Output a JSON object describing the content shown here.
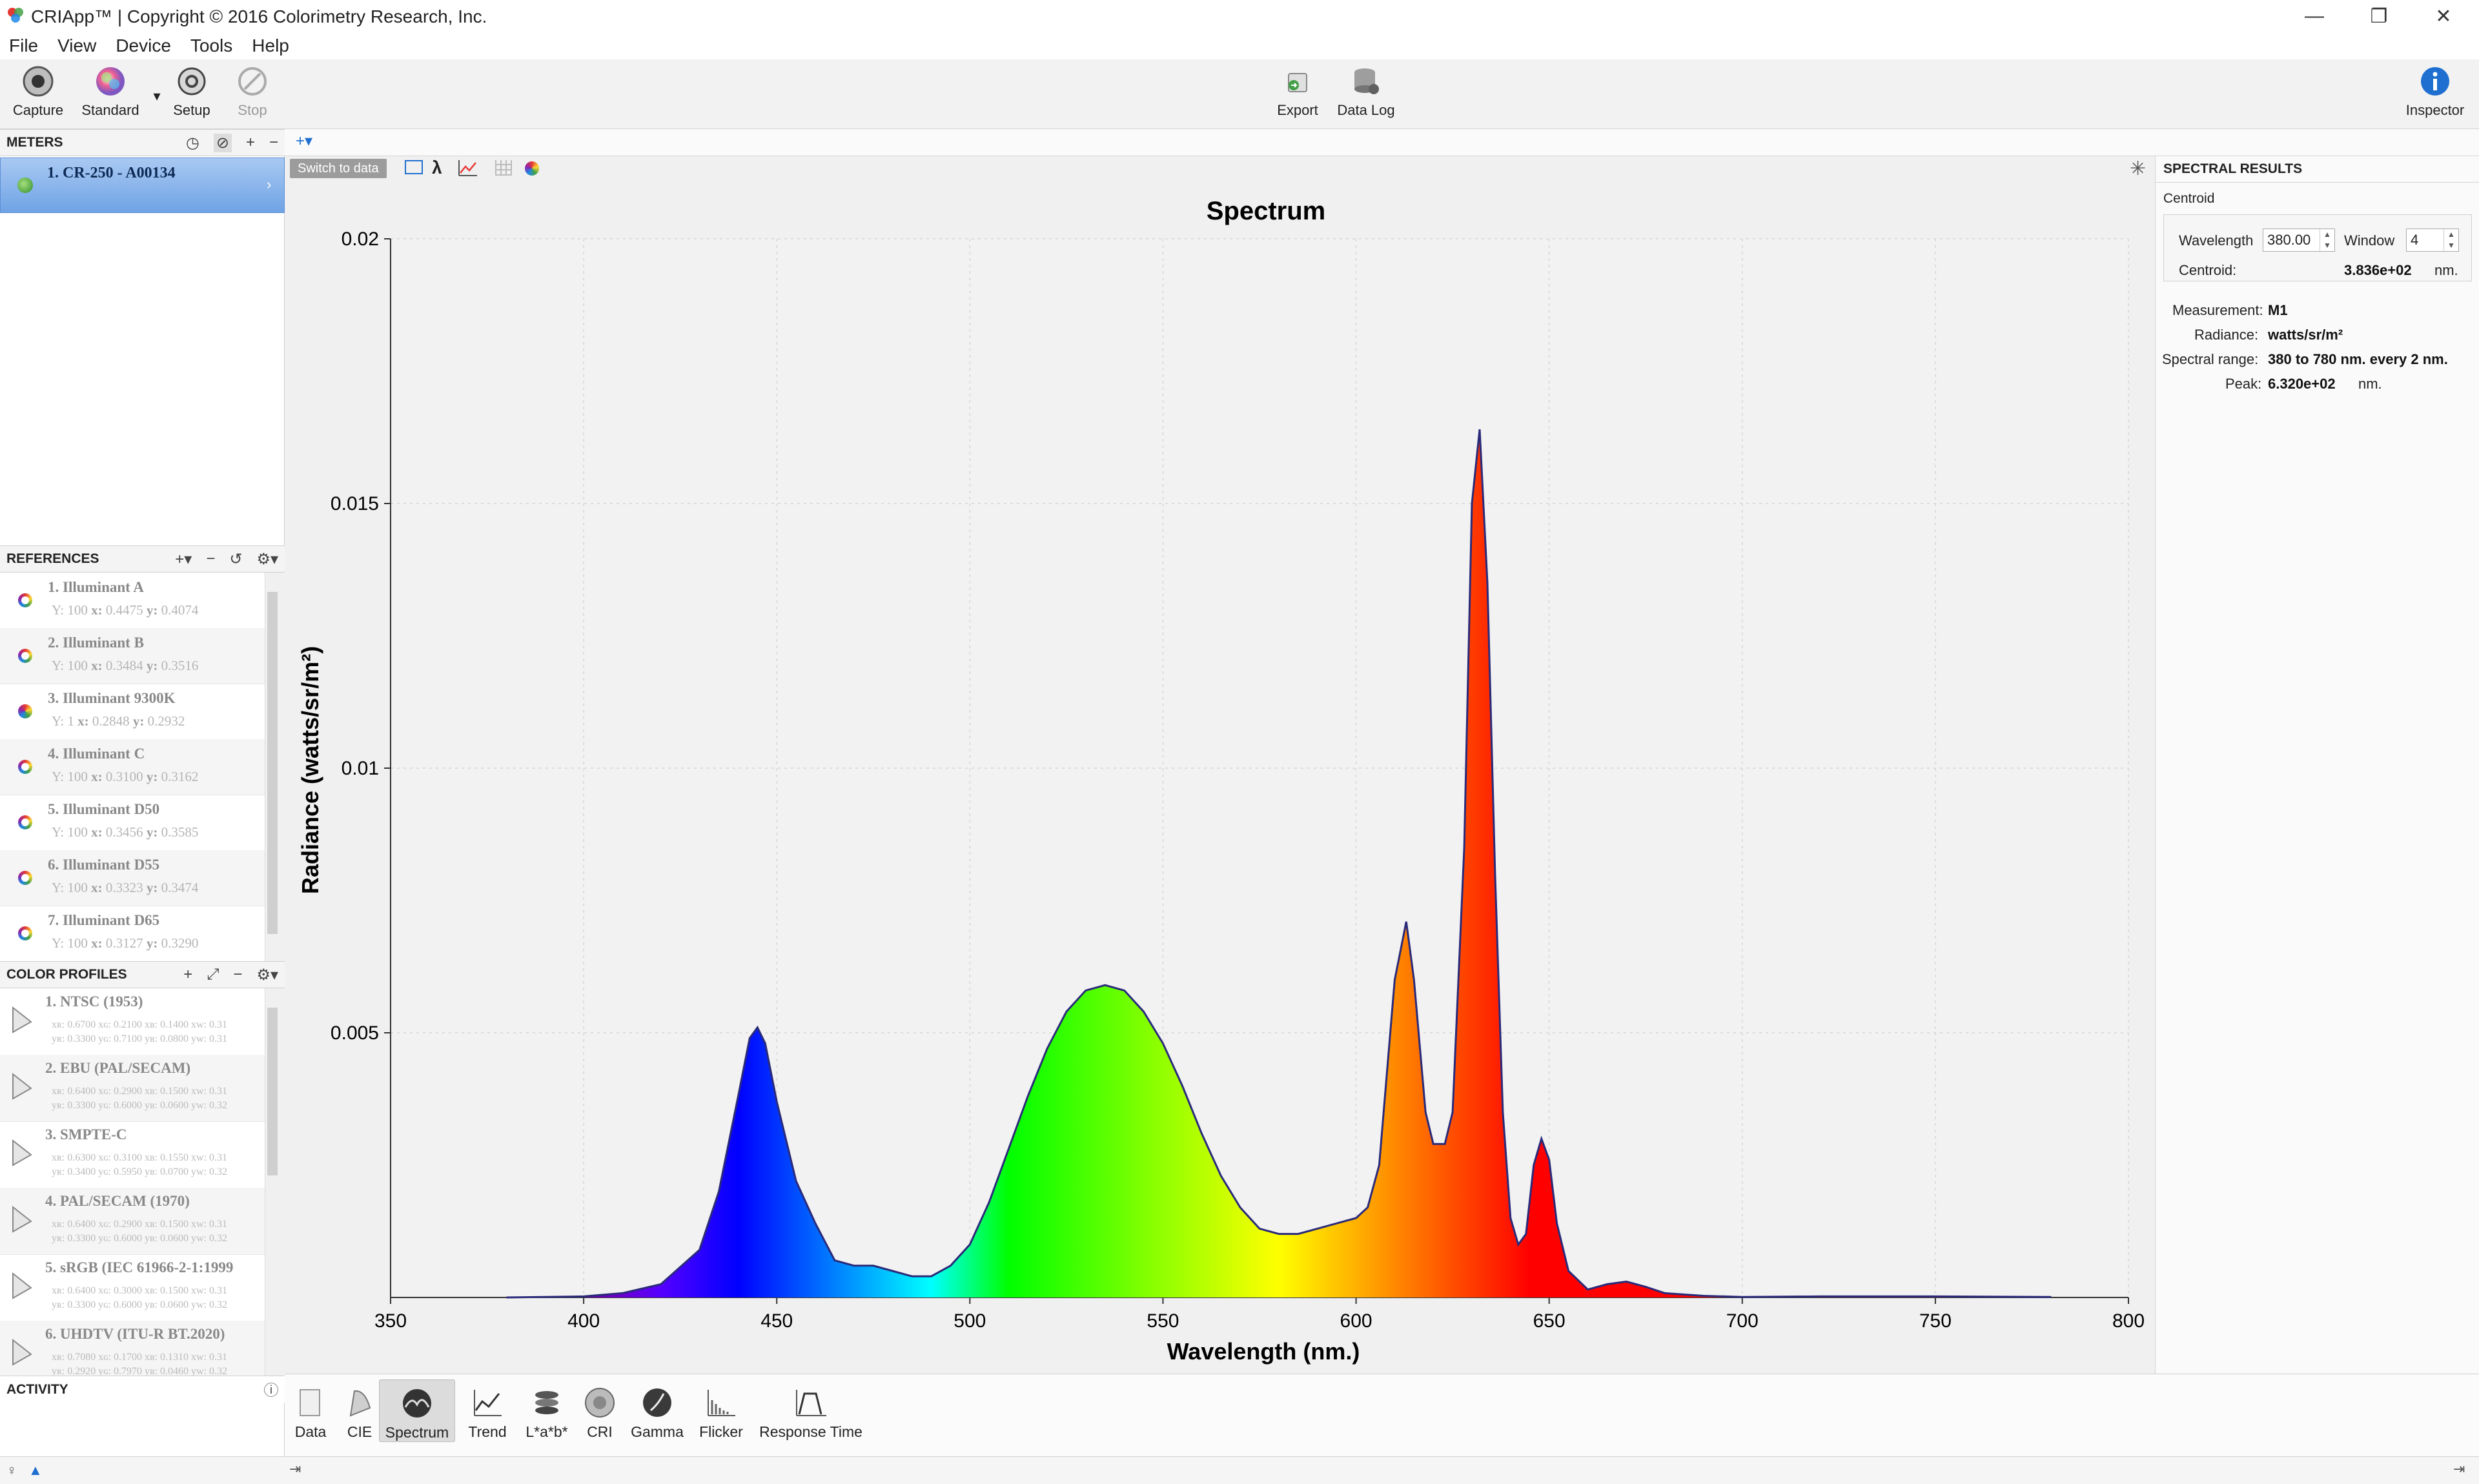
{
  "window": {
    "title": "CRIApp™ | Copyright © 2016 Colorimetry Research, Inc.",
    "minimize": "—",
    "maximize": "❐",
    "close": "✕"
  },
  "menu": [
    "File",
    "View",
    "Device",
    "Tools",
    "Help"
  ],
  "toolbar": {
    "capture": "Capture",
    "standard": "Standard",
    "setup": "Setup",
    "stop": "Stop",
    "export": "Export",
    "data_log": "Data Log",
    "inspector": "Inspector"
  },
  "meters": {
    "header": "METERS",
    "items": [
      {
        "name": "1. CR-250 - A00134"
      }
    ]
  },
  "references": {
    "header": "REFERENCES",
    "items": [
      {
        "name": "1. Illuminant A",
        "Y": "100",
        "x": "0.4475",
        "y": "0.4074",
        "solid": false
      },
      {
        "name": "2. Illuminant B",
        "Y": "100",
        "x": "0.3484",
        "y": "0.3516",
        "solid": false
      },
      {
        "name": "3. Illuminant 9300K",
        "Y": "1",
        "x": "0.2848",
        "y": "0.2932",
        "solid": true
      },
      {
        "name": "4. Illuminant C",
        "Y": "100",
        "x": "0.3100",
        "y": "0.3162",
        "solid": false
      },
      {
        "name": "5. Illuminant D50",
        "Y": "100",
        "x": "0.3456",
        "y": "0.3585",
        "solid": false
      },
      {
        "name": "6. Illuminant D55",
        "Y": "100",
        "x": "0.3323",
        "y": "0.3474",
        "solid": false
      },
      {
        "name": "7. Illuminant D65",
        "Y": "100",
        "x": "0.3127",
        "y": "0.3290",
        "solid": false
      }
    ]
  },
  "color_profiles": {
    "header": "COLOR PROFILES",
    "items": [
      {
        "name": "1. NTSC (1953)",
        "row1": "xʀ: 0.6700  xɢ: 0.2100  xʙ: 0.1400  xᴡ: 0.31",
        "row2": "yʀ: 0.3300  yɢ: 0.7100  yʙ: 0.0800  yᴡ: 0.31"
      },
      {
        "name": "2. EBU (PAL/SECAM)",
        "row1": "xʀ: 0.6400  xɢ: 0.2900  xʙ: 0.1500  xᴡ: 0.31",
        "row2": "yʀ: 0.3300  yɢ: 0.6000  yʙ: 0.0600  yᴡ: 0.32"
      },
      {
        "name": "3. SMPTE-C",
        "row1": "xʀ: 0.6300  xɢ: 0.3100  xʙ: 0.1550  xᴡ: 0.31",
        "row2": "yʀ: 0.3400  yɢ: 0.5950  yʙ: 0.0700  yᴡ: 0.32"
      },
      {
        "name": "4. PAL/SECAM (1970)",
        "row1": "xʀ: 0.6400  xɢ: 0.2900  xʙ: 0.1500  xᴡ: 0.31",
        "row2": "yʀ: 0.3300  yɢ: 0.6000  yʙ: 0.0600  yᴡ: 0.32"
      },
      {
        "name": "5. sRGB (IEC 61966-2-1:1999",
        "row1": "xʀ: 0.6400  xɢ: 0.3000  xʙ: 0.1500  xᴡ: 0.31",
        "row2": "yʀ: 0.3300  yɢ: 0.6000  yʙ: 0.0600  yᴡ: 0.32"
      },
      {
        "name": "6. UHDTV (ITU-R BT.2020)",
        "row1": "xʀ: 0.7080  xɢ: 0.1700  xʙ: 0.1310  xᴡ: 0.31",
        "row2": "yʀ: 0.2920  yɢ: 0.7970  yʙ: 0.0460  yᴡ: 0.32"
      }
    ]
  },
  "activity": {
    "header": "ACTIVITY"
  },
  "chart_toolbar": {
    "switch_label": "Switch to data",
    "lambda": "λ"
  },
  "chart_data": {
    "type": "area",
    "title": "Spectrum",
    "xlabel": "Wavelength (nm.)",
    "ylabel": "Radiance (watts/sr/m²)",
    "xlim": [
      350,
      800
    ],
    "ylim": [
      0,
      0.02
    ],
    "xticks": [
      350,
      400,
      450,
      500,
      550,
      600,
      650,
      700,
      750,
      800
    ],
    "yticks": [
      0.005,
      0.01,
      0.015,
      0.02
    ],
    "ytick_labels": [
      "0.005",
      "0.01",
      "0.015",
      "0.02"
    ],
    "grid": true,
    "fill": "wavelength-colored",
    "x": [
      380,
      400,
      410,
      420,
      430,
      435,
      440,
      443,
      445,
      447,
      450,
      455,
      460,
      465,
      470,
      475,
      480,
      485,
      490,
      495,
      500,
      505,
      510,
      515,
      520,
      525,
      530,
      535,
      540,
      545,
      550,
      555,
      560,
      565,
      570,
      575,
      580,
      585,
      590,
      595,
      600,
      603,
      606,
      610,
      613,
      615,
      618,
      620,
      623,
      625,
      628,
      630,
      632,
      634,
      636,
      638,
      640,
      642,
      644,
      646,
      648,
      650,
      652,
      655,
      660,
      665,
      670,
      675,
      680,
      690,
      700,
      720,
      750,
      780
    ],
    "y": [
      0,
      2e-05,
      8e-05,
      0.00025,
      0.0009,
      0.002,
      0.0038,
      0.0049,
      0.0051,
      0.0048,
      0.0037,
      0.0022,
      0.0014,
      0.0007,
      0.0006,
      0.0006,
      0.0005,
      0.0004,
      0.0004,
      0.0006,
      0.001,
      0.0018,
      0.0028,
      0.0038,
      0.0047,
      0.0054,
      0.0058,
      0.0059,
      0.0058,
      0.0054,
      0.0048,
      0.004,
      0.0031,
      0.0023,
      0.0017,
      0.0013,
      0.0012,
      0.0012,
      0.0013,
      0.0014,
      0.0015,
      0.0017,
      0.0025,
      0.006,
      0.0071,
      0.006,
      0.0035,
      0.0029,
      0.0029,
      0.0035,
      0.0085,
      0.015,
      0.0164,
      0.0135,
      0.008,
      0.0035,
      0.0015,
      0.001,
      0.0012,
      0.0025,
      0.003,
      0.0026,
      0.0014,
      0.0005,
      0.00015,
      0.00025,
      0.0003,
      0.0002,
      8e-05,
      3e-05,
      1e-05,
      2e-05,
      2e-05,
      1e-05
    ]
  },
  "spectral_results": {
    "header": "SPECTRAL RESULTS",
    "group": "Centroid",
    "wavelength_label": "Wavelength",
    "wavelength_value": "380.00",
    "window_label": "Window",
    "window_value": "4",
    "centroid_label": "Centroid:",
    "centroid_value": "3.836e+02",
    "centroid_unit": "nm.",
    "measurement_label": "Measurement:",
    "measurement_value": "M1",
    "radiance_label": "Radiance:",
    "radiance_value": "watts/sr/m²",
    "range_label": "Spectral range:",
    "range_value": "380 to 780 nm. every 2 nm.",
    "peak_label": "Peak:",
    "peak_value": "6.320e+02",
    "peak_unit": "nm."
  },
  "bottom_tabs": [
    "Data",
    "CIE",
    "Spectrum",
    "Trend",
    "L*a*b*",
    "CRI",
    "Gamma",
    "Flicker",
    "Response Time"
  ],
  "active_tab": "Spectrum"
}
